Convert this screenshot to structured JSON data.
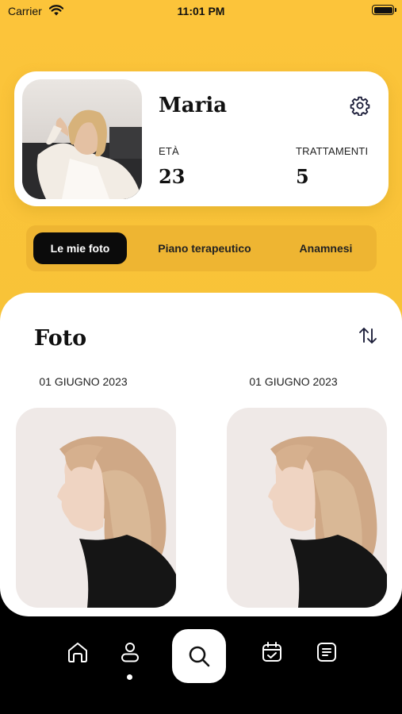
{
  "status_bar": {
    "carrier": "Carrier",
    "time": "11:01 PM"
  },
  "profile": {
    "name": "Maria",
    "age_label": "ETÀ",
    "age_value": "23",
    "treatments_label": "TRATTAMENTI",
    "treatments_value": "5",
    "settings_icon": "gear-icon",
    "avatar_icon": "profile-photo"
  },
  "tabs": [
    {
      "label": "Le mie foto",
      "active": true
    },
    {
      "label": "Piano terapeutico",
      "active": false
    },
    {
      "label": "Anamnesi",
      "active": false
    }
  ],
  "photos_section": {
    "title": "Foto",
    "sort_icon": "sort-arrows-icon",
    "items": [
      {
        "date": "01 GIUGNO 2023"
      },
      {
        "date": "01 GIUGNO 2023"
      }
    ]
  },
  "tab_bar": {
    "items": [
      "home-icon",
      "profile-icon",
      "search-icon",
      "calendar-check-icon",
      "list-icon"
    ],
    "active": "profile-icon"
  },
  "colors": {
    "accent_yellow": "#fcc43a",
    "tab_track": "#eeb532",
    "active_tab": "#0b0b0b",
    "background_dark": "#000000"
  }
}
